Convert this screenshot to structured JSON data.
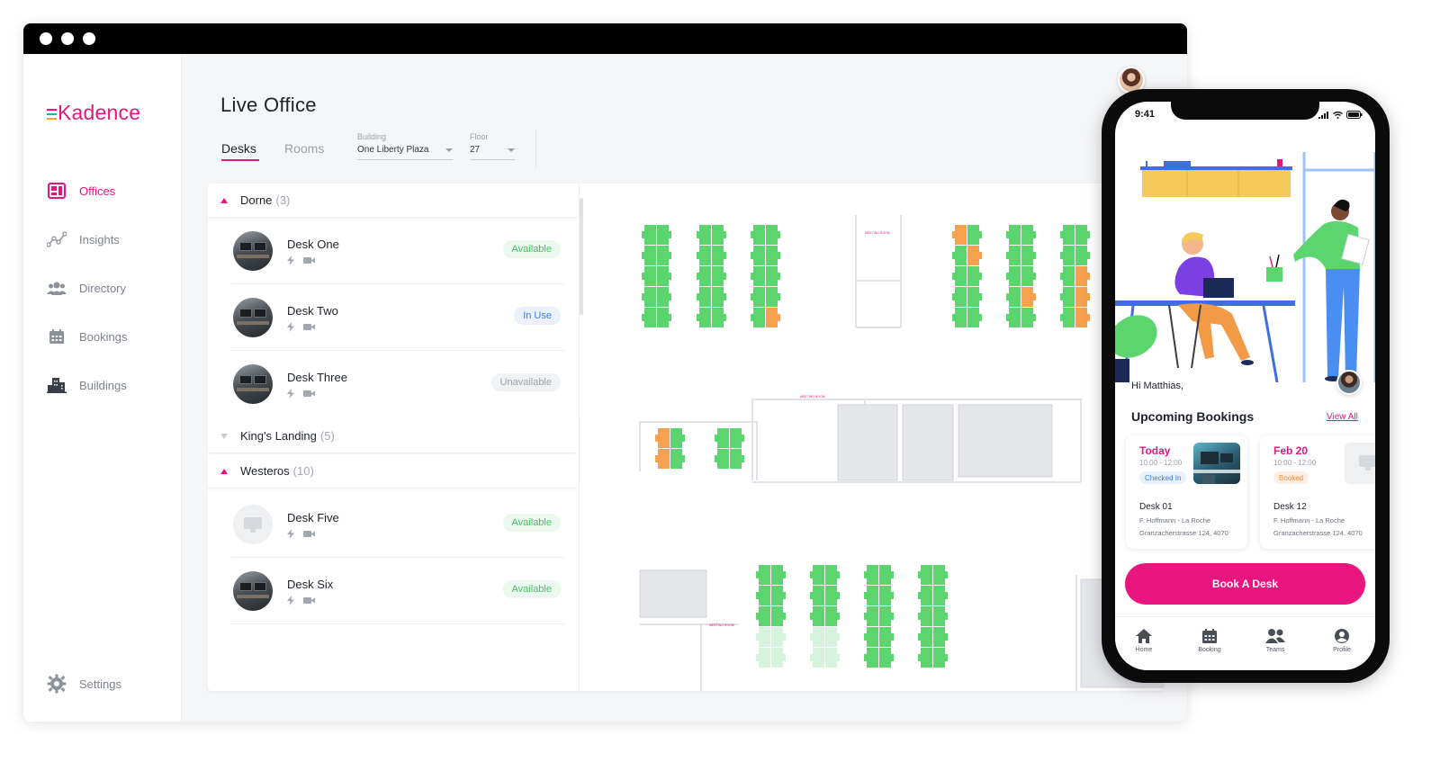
{
  "app": {
    "logo": "Kadence",
    "brand_color": "#e5177e",
    "status_colors": {
      "available": "#5cd56f",
      "occupied": "#f7a04d",
      "unavailable": "#cfd3d8"
    }
  },
  "sidebar": {
    "items": [
      {
        "label": "Offices",
        "icon": "offices-icon",
        "active": true
      },
      {
        "label": "Insights",
        "icon": "insights-icon",
        "active": false
      },
      {
        "label": "Directory",
        "icon": "directory-icon",
        "active": false
      },
      {
        "label": "Bookings",
        "icon": "calendar-icon",
        "active": false
      },
      {
        "label": "Buildings",
        "icon": "buildings-icon",
        "active": false
      }
    ],
    "settings_label": "Settings"
  },
  "header": {
    "title": "Live Office",
    "tabs": [
      {
        "label": "Desks",
        "active": true
      },
      {
        "label": "Rooms",
        "active": false
      }
    ],
    "building": {
      "label": "Building",
      "value": "One Liberty Plaza"
    },
    "floor": {
      "label": "Floor",
      "value": "27"
    }
  },
  "desk_list": {
    "groups": [
      {
        "name": "Dorne",
        "count": "(3)",
        "expanded": true
      },
      {
        "name": "King's Landing",
        "count": "(5)",
        "expanded": false
      },
      {
        "name": "Westeros",
        "count": "(10)",
        "expanded": true
      }
    ],
    "desks": [
      {
        "name": "Desk One",
        "status": "Available"
      },
      {
        "name": "Desk Two",
        "status": "In Use"
      },
      {
        "name": "Desk Three",
        "status": "Unavailable"
      },
      {
        "name": "Desk Five",
        "status": "Available"
      },
      {
        "name": "Desk Six",
        "status": "Available"
      }
    ]
  },
  "phone": {
    "time": "9:41",
    "greeting": "Hi Matthias,",
    "section_title": "Upcoming Bookings",
    "view_all": "View All",
    "bookings": [
      {
        "when": "Today",
        "time": "10:00 - 12:00",
        "badge": "Checked In",
        "desk": "Desk 01",
        "host": "F. Hoffmann - La Roche",
        "address": "Granzacherstrasse 124, 4070"
      },
      {
        "when": "Feb 20",
        "time": "10:00 - 12:00",
        "badge": "Booked",
        "desk": "Desk 12",
        "host": "F. Hoffmann - La Roche",
        "address": "Granzacherstrasse 124, 4070"
      }
    ],
    "book_button": "Book A Desk",
    "tabbar": [
      {
        "label": "Home",
        "icon": "home-icon"
      },
      {
        "label": "Booking",
        "icon": "calendar-icon"
      },
      {
        "label": "Teams",
        "icon": "teams-icon"
      },
      {
        "label": "Profile",
        "icon": "profile-icon"
      }
    ]
  }
}
